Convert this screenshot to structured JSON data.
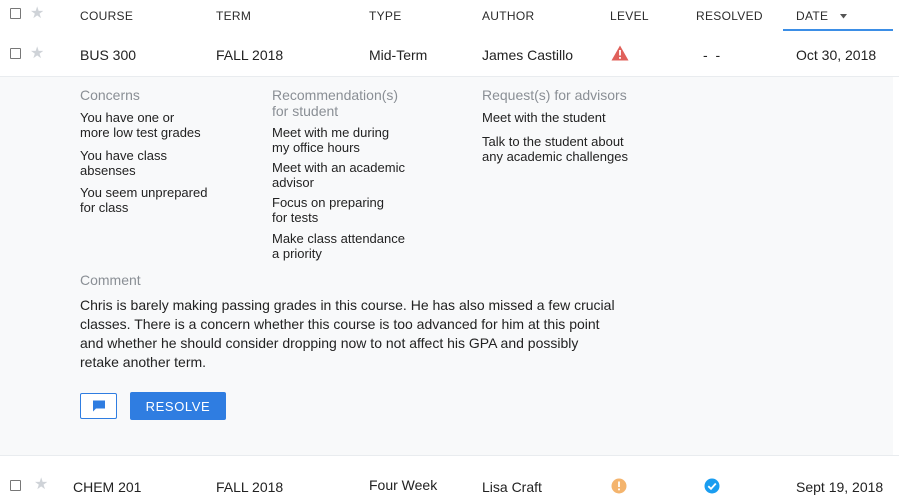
{
  "header": {
    "course": "COURSE",
    "term": "TERM",
    "type": "TYPE",
    "author": "AUTHOR",
    "level": "LEVEL",
    "resolved": "RESOLVED",
    "date": "DATE",
    "sort_icon": "caret-down-icon"
  },
  "rows": [
    {
      "course": "BUS 300",
      "term": "FALL 2018",
      "type": "Mid-Term",
      "author": "James Castillo",
      "level_icon": "warning-triangle-icon",
      "level_color": "#e0605a",
      "resolved": "- -",
      "date": "Oct 30, 2018"
    },
    {
      "course": "CHEM 201",
      "term": "FALL 2018",
      "type": "Four Week",
      "author": "Lisa Craft",
      "level_icon": "alert-circle-icon",
      "level_color": "#f4b46d",
      "resolved_icon": "check-circle-icon",
      "resolved_color": "#1a9df0",
      "date": "Sept 19, 2018"
    }
  ],
  "details": {
    "concerns_title": "Concerns",
    "concerns": [
      "You have one or\nmore low test grades",
      "You have class\nabsenses",
      "You seem unprepared\nfor class"
    ],
    "recommendations_title": "Recommendation(s)\nfor student",
    "recommendations": [
      "Meet with me during\nmy office hours",
      "Meet with an academic\nadvisor",
      "Focus on preparing\nfor tests",
      "Make class attendance\na priority"
    ],
    "requests_title": "Request(s) for advisors",
    "requests": [
      "Meet with the student",
      "Talk to the student about\nany academic challenges"
    ],
    "comment_title": "Comment",
    "comment": "Chris is barely making passing grades in this course. He has also missed a few crucial classes. There is a concern whether this course is too advanced for him at this point and whether he should consider dropping now to not affect his GPA and possibly retake another term.",
    "message_icon": "chat-bubble-icon",
    "resolve_label": "RESOLVE"
  },
  "colors": {
    "accent": "#2f7de1",
    "panel_bg": "#f8f9fa"
  }
}
